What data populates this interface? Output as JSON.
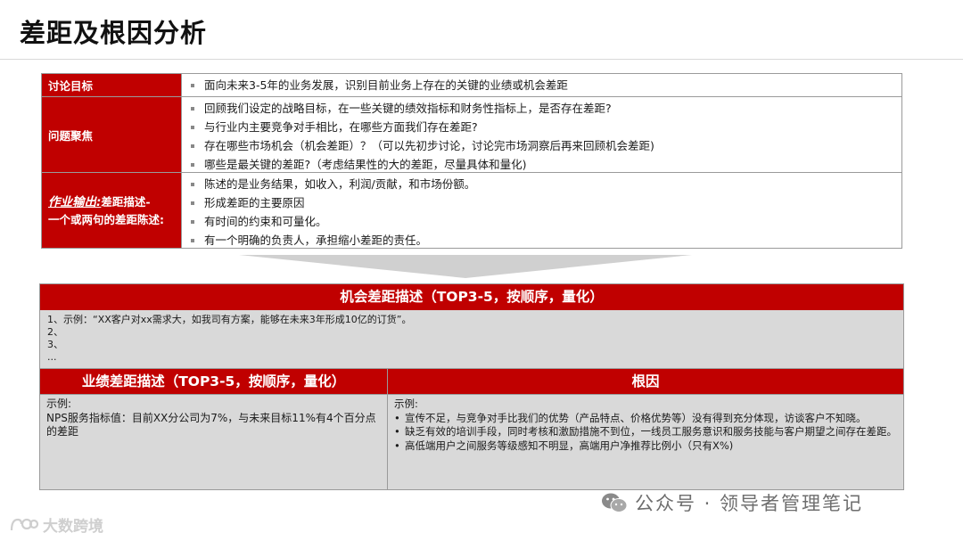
{
  "title": "差距及根因分析",
  "top_table": {
    "rows": [
      {
        "label": "讨论目标",
        "items": [
          "面向未来3-5年的业务发展，识别目前业务上存在的关键的业绩或机会差距"
        ]
      },
      {
        "label": "问题聚焦",
        "items": [
          "回顾我们设定的战略目标，在一些关键的绩效指标和财务性指标上，是否存在差距?",
          "与行业内主要竞争对手相比，在哪些方面我们存在差距?",
          "存在哪些市场机会（机会差距）？（可以先初步讨论，讨论完市场洞察后再来回顾机会差距)",
          "哪些是最关键的差距?（考虑结果性的大的差距，尽量具体和量化)"
        ]
      },
      {
        "label_emph": "作业输出:",
        "label_rest": "差距描述-",
        "label_line2": "一个或两句的差距陈述:",
        "items": [
          "陈述的是业务结果，如收入，利润/贡献，和市场份额。",
          "形成差距的主要原因",
          "有时间的约束和可量化。",
          "有一个明确的负责人，承担缩小差距的责任。"
        ]
      }
    ]
  },
  "opportunity": {
    "header": "机会差距描述（TOP3-5，按顺序，量化）",
    "lines": [
      "1、示例：“XX客户对xx需求大，如我司有方案，能够在未来3年形成10亿的订货”。",
      "2、",
      "3、",
      "..."
    ]
  },
  "performance": {
    "header": "业绩差距描述（TOP3-5，按顺序，量化）",
    "example_label": "示例:",
    "text": "NPS服务指标值：目前XX分公司为7%，与未来目标11%有4个百分点的差距"
  },
  "root_cause": {
    "header": "根因",
    "example_label": "示例:",
    "items": [
      "宣传不足，与竞争对手比我们的优势（产品特点、价格优势等）没有得到充分体现，访谈客户不知晓。",
      "缺乏有效的培训手段，同时考核和激励措施不到位，一线员工服务意识和服务技能与客户期望之间存在差距。",
      "高低端用户之间服务等级感知不明显，高端用户净推荐比例小（只有X%)"
    ]
  },
  "watermark_right": "公众号 · 领导者管理笔记",
  "watermark_left": "大数跨境",
  "colors": {
    "accent": "#c00000",
    "panel": "#d9d9d9"
  }
}
